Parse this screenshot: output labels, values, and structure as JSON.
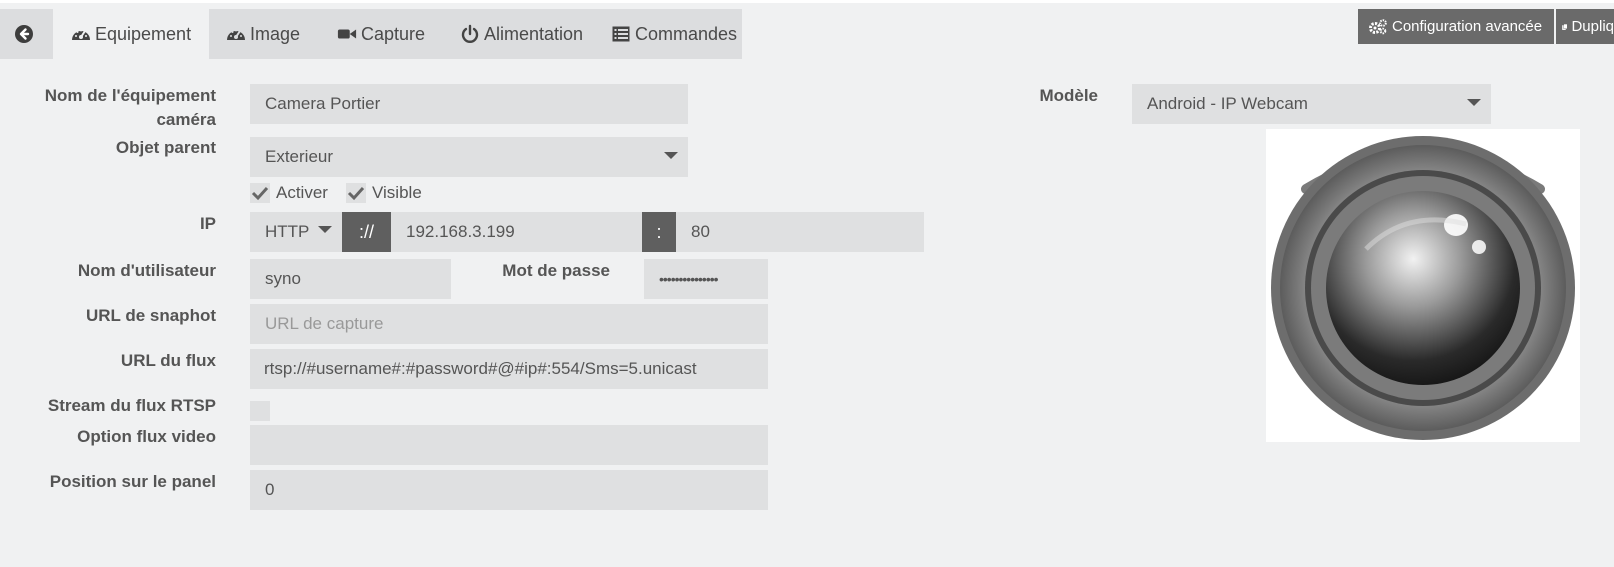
{
  "tabs": [
    {
      "label": "Equipement",
      "icon": "tachometer-icon"
    },
    {
      "label": "Image",
      "icon": "tachometer-icon"
    },
    {
      "label": "Capture",
      "icon": "video-camera-icon"
    },
    {
      "label": "Alimentation",
      "icon": "power-icon"
    },
    {
      "label": "Commandes",
      "icon": "list-icon"
    }
  ],
  "toolbar": {
    "advanced_config": "Configuration avancée",
    "duplicate": "Dupliq"
  },
  "form": {
    "name_label_line1": "Nom de l'équipement",
    "name_label_line2": "caméra",
    "name_value": "Camera Portier",
    "parent_label": "Objet parent",
    "parent_value": "Exterieur",
    "activate_label": "Activer",
    "visible_label": "Visible",
    "ip_label": "IP",
    "protocol_value": "HTTP",
    "protocol_sep": "://",
    "ip_value": "192.168.3.199",
    "port_sep": ":",
    "port_value": "80",
    "username_label": "Nom d'utilisateur",
    "username_value": "syno",
    "password_label": "Mot de passe",
    "password_value": "•••••••••••••••",
    "snapshot_label": "URL de snaphot",
    "snapshot_placeholder": "URL de capture",
    "stream_label": "URL du flux",
    "stream_value": "rtsp://#username#:#password#@#ip#:554/Sms=5.unicast",
    "rtsp_label": "Stream du flux RTSP",
    "video_option_label": "Option flux video",
    "video_option_value": "",
    "panel_position_label": "Position sur le panel",
    "panel_position_value": "0"
  },
  "model": {
    "label": "Modèle",
    "value": "Android - IP Webcam"
  }
}
